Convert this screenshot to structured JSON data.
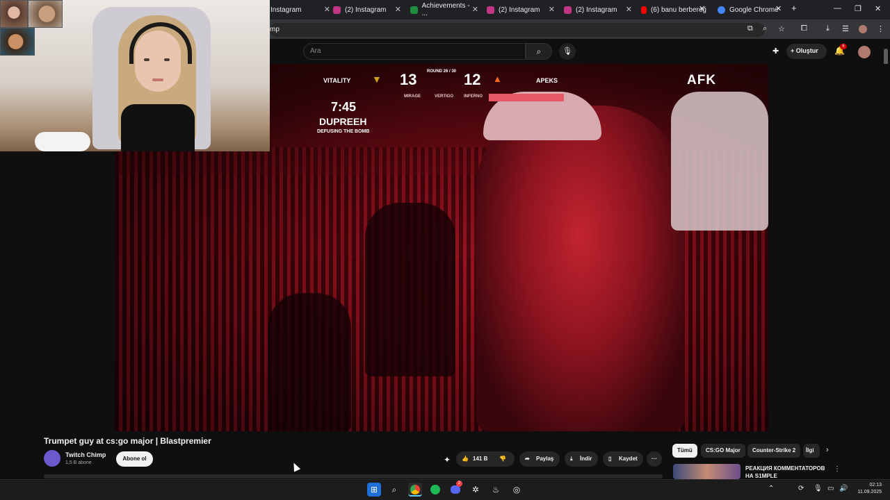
{
  "browser": {
    "tabs": [
      {
        "label": "Instagram",
        "color": "#c13584"
      },
      {
        "label": "(2) Instagram",
        "color": "#c13584"
      },
      {
        "label": "Achievements - ...",
        "color": "#1e8f3e"
      },
      {
        "label": "(2) Instagram",
        "color": "#c13584"
      },
      {
        "label": "(2) Instagram",
        "color": "#c13584"
      },
      {
        "label": "(6) banu berberoğ",
        "color": "#ff0000"
      },
      {
        "label": "Google Chrome",
        "color": "#4285f4"
      }
    ],
    "address_fragment": "mp",
    "new_tab": "+",
    "minimize": "—",
    "maximize": "❐",
    "close": "✕"
  },
  "youtube": {
    "search_placeholder": "Ara",
    "create_label": "Oluştur",
    "notification_count": "6"
  },
  "video": {
    "hud": {
      "team_left": "VITALITY",
      "score_left": "13",
      "round": "ROUND 26 / 30",
      "score_right": "12",
      "team_right": "APEKS",
      "maps": [
        "MIRAGE",
        "VERTIGO",
        "INFERNO"
      ],
      "timer": "7:45",
      "player": "DUPREEH",
      "action": "DEFUSING THE BOMB",
      "sponsor": "AFK"
    }
  },
  "info": {
    "title": "Trumpet guy at cs:go major | Blastpremier",
    "channel": "Twitch Chimp",
    "subscribers": "1,5 B abone",
    "subscribe_label": "Abone ol",
    "likes": "141 B",
    "share_label": "Paylaş",
    "download_label": "İndir",
    "save_label": "Kaydet",
    "more": "···"
  },
  "sidebar": {
    "chips": [
      "Tümü",
      "CS:GO Major",
      "Counter-Strike 2",
      "İlgi"
    ],
    "rec_title": "РЕАКЦИЯ КОММЕНТАТОРОВ НА S1MPLE"
  },
  "taskbar": {
    "time": "02:13",
    "date": "11.09.2025",
    "discord_badge": "2"
  },
  "colors": {
    "youtube_red": "#ff0000",
    "accent_gold": "#d4a017",
    "apeks_orange": "#ff6a1a"
  }
}
